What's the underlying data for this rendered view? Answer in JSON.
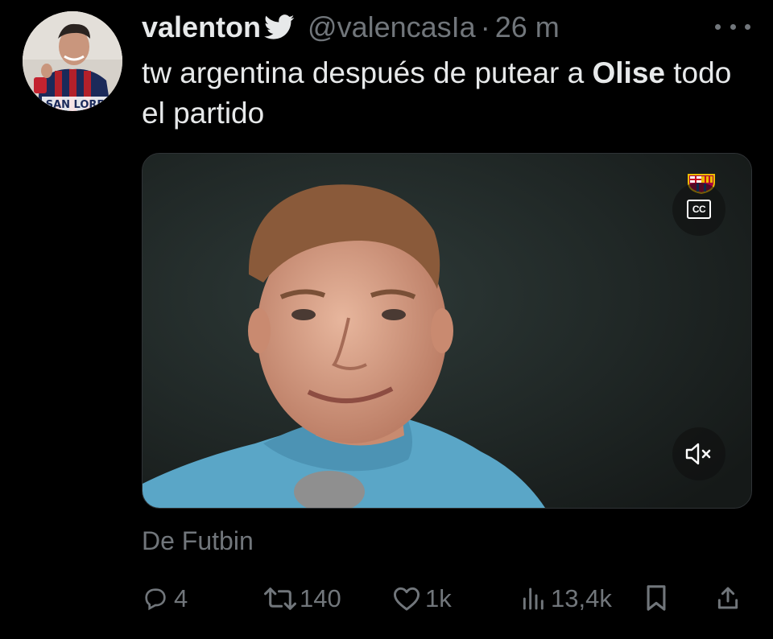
{
  "author": {
    "display_name": "valenton",
    "handle": "@valencasIa",
    "separator": "·",
    "time": "26 m",
    "avatar_text": "SAN LORE"
  },
  "icons": {
    "badge": "twitter-bird-icon",
    "more": "more-icon",
    "cc": "closed-captions-icon",
    "mute": "mute-icon",
    "reply": "reply-icon",
    "retweet": "retweet-icon",
    "like": "heart-icon",
    "views": "views-icon",
    "bookmark": "bookmark-icon",
    "share": "share-icon"
  },
  "tweet": {
    "text_before": "tw argentina después de putear a ",
    "text_bold": "Olise",
    "text_after": " todo el partido"
  },
  "media": {
    "cc_label": "CC",
    "source": "De Futbin"
  },
  "metrics": {
    "replies": "4",
    "retweets": "140",
    "likes": "1k",
    "views": "13,4k"
  },
  "colors": {
    "background": "#000000",
    "text": "#e7e9ea",
    "muted": "#71767b"
  }
}
